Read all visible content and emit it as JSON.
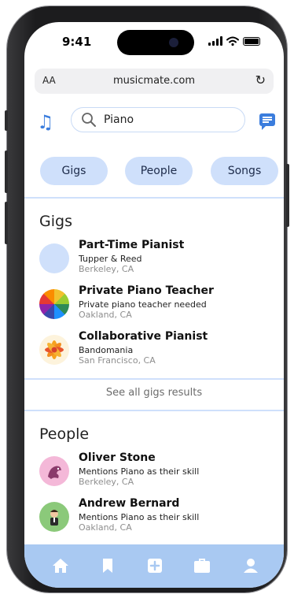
{
  "status": {
    "time": "9:41"
  },
  "browser": {
    "text_size": "AA",
    "url": "musicmate.com",
    "reload_icon": "reload-icon"
  },
  "header": {
    "logo_icon": "music-note-icon",
    "search_value": "Piano",
    "chat_icon": "chat-icon"
  },
  "filters": [
    "Gigs",
    "People",
    "Songs"
  ],
  "gigs": {
    "title": "Gigs",
    "items": [
      {
        "title": "Part-Time Pianist",
        "subtitle": "Tupper & Reed",
        "location": "Berkeley, CA"
      },
      {
        "title": "Private Piano Teacher",
        "subtitle": "Private piano teacher needed",
        "location": "Oakland, CA"
      },
      {
        "title": "Collaborative Pianist",
        "subtitle": "Bandomania",
        "location": "San Francisco, CA"
      }
    ],
    "see_all": "See all gigs results"
  },
  "people": {
    "title": "People",
    "items": [
      {
        "name": "Oliver Stone",
        "subtitle": "Mentions Piano as their skill",
        "location": "Berkeley, CA"
      },
      {
        "name": "Andrew Bernard",
        "subtitle": "Mentions Piano as their skill",
        "location": "Oakland, CA"
      }
    ]
  },
  "tabbar": [
    "home-icon",
    "bookmark-icon",
    "add-icon",
    "briefcase-icon",
    "profile-icon"
  ],
  "colors": {
    "accent": "#3b7ddd",
    "chip": "#cfe0fb",
    "tabbar": "#a9c9f2"
  }
}
